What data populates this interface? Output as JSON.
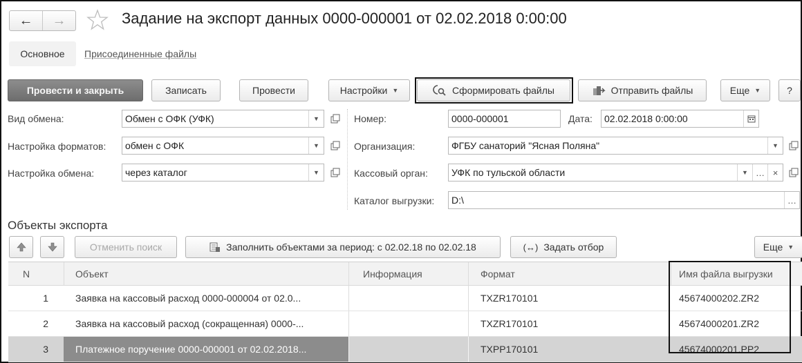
{
  "window": {
    "title": "Задание на экспорт данных 0000-000001 от 02.02.2018 0:00:00",
    "nav_back": "←",
    "nav_forward": "→"
  },
  "tabs": [
    {
      "label": "Основное",
      "active": true
    },
    {
      "label": "Присоединенные файлы",
      "active": false
    }
  ],
  "toolbar": {
    "post_close": "Провести и закрыть",
    "save": "Записать",
    "post": "Провести",
    "settings": "Настройки",
    "form_files": "Сформировать файлы",
    "send_files": "Отправить файлы",
    "more": "Еще",
    "help": "?"
  },
  "form": {
    "exchange_type": {
      "label": "Вид обмена:",
      "value": "Обмен с ОФК (УФК)"
    },
    "format_settings": {
      "label": "Настройка форматов:",
      "value": "обмен с ОФК"
    },
    "exchange_settings": {
      "label": "Настройка обмена:",
      "value": "через каталог"
    },
    "number": {
      "label": "Номер:",
      "value": "0000-000001"
    },
    "date": {
      "label": "Дата:",
      "value": "02.02.2018  0:00:00"
    },
    "organization": {
      "label": "Организация:",
      "value": "ФГБУ санаторий \"Ясная Поляна\""
    },
    "cash_body": {
      "label": "Кассовый орган:",
      "value": "УФК по тульской области"
    },
    "export_dir": {
      "label": "Каталог выгрузки:",
      "value": "D:\\"
    }
  },
  "objects": {
    "title": "Объекты экспорта",
    "cancel_search": "Отменить поиск",
    "fill_period": "Заполнить объектами за период: с 02.02.18 по 02.02.18",
    "set_filter": "Задать отбор",
    "more": "Еще",
    "columns": [
      "N",
      "Объект",
      "Информация",
      "Формат",
      "Имя файла выгрузки"
    ],
    "rows": [
      {
        "n": "1",
        "object": "Заявка на кассовый расход 0000-000004 от 02.0...",
        "info": "",
        "format": "TXZR170101",
        "file": "45674000202.ZR2"
      },
      {
        "n": "2",
        "object": "Заявка на кассовый расход (сокращенная) 0000-...",
        "info": "",
        "format": "TXZR170101",
        "file": "45674000201.ZR2"
      },
      {
        "n": "3",
        "object": "Платежное поручение 0000-000001 от 02.02.2018...",
        "info": "",
        "format": "TXPP170101",
        "file": "45674000201.PP2",
        "selected": true
      }
    ]
  },
  "colors": {
    "primary_button": "#7a7a7a",
    "selected_row": "#d4d4d4",
    "selected_cell": "#8c8c8c",
    "highlight_border": "#111111"
  }
}
